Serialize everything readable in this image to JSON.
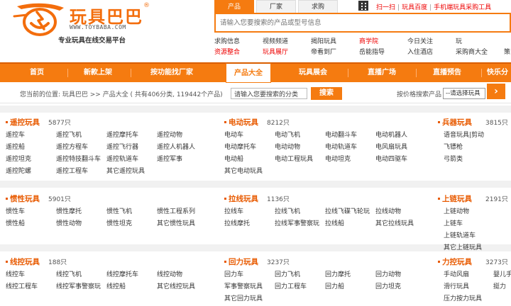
{
  "brand": {
    "name": "玩具巴巴",
    "reg": "®",
    "url": "WWW.TOYBABA.COM",
    "tagline": "专业玩具在线交易平台"
  },
  "search": {
    "tabs": [
      "产品",
      "厂家",
      "求购"
    ],
    "placeholder": "请输入您要搜索的产品或型号信息"
  },
  "top_links": {
    "scan": "扫一扫",
    "baidu": "玩具百度",
    "mobile": "手机端玩具采购工具"
  },
  "quick_links": {
    "row1": [
      "求购信息",
      "视频频道",
      "揭阳玩具",
      "商学院",
      "今日关注",
      "玩"
    ],
    "row2": [
      "资源整合",
      "玩具展厅",
      "帝看到厂",
      "岳能指导",
      "入住酒店",
      "采购商大全",
      "策"
    ],
    "row3": [
      "找物流",
      "玩具论坛",
      "我要采购",
      "行业资讯",
      "最新展会",
      "玩具网址",
      "更"
    ]
  },
  "nav": {
    "items": [
      "首页",
      "新款上架",
      "按功能找厂家",
      "产品大全",
      "玩具展会",
      "直播广场",
      "直播预告",
      "快乐分"
    ],
    "arrow": "›"
  },
  "crumb": {
    "text": "您当前的位置: 玩具巴巴 >> 产品大全 ( 共有406分类, 119442个产品)",
    "search_value": "请输入您要搜索的分类",
    "search_btn": "搜索",
    "cat_label": "按价格搜索产品",
    "cat_select": "--请选择玩具"
  },
  "categories": [
    {
      "title": "遥控玩具",
      "count": "5877只",
      "items": [
        "遥控车",
        "遥控飞机",
        "遥控摩托车",
        "遥控动物",
        "遥控船",
        "遥控方程车",
        "遥控飞行器",
        "遥控人机器人",
        "遥控坦克",
        "遥控特技翻斗车",
        "遥控轨道车",
        "遥控军事",
        "遥控陀螺",
        "遥控工程车",
        "其它遥控玩具"
      ]
    },
    {
      "title": "电动玩具",
      "count": "8212只",
      "items": [
        "电动车",
        "电动飞机",
        "电动翻斗车",
        "电动机器人",
        "电动摩托车",
        "电动动物",
        "电动轨道车",
        "电风扇玩具",
        "电动船",
        "电动工程玩具",
        "电动坦克",
        "电动四驱车",
        "其它电动玩具"
      ]
    },
    {
      "title": "兵器玩具",
      "count": "3815只",
      "items": [
        "语音玩具|剪动",
        "飞镖枪",
        "弓箭类"
      ]
    },
    {
      "title": "惯性玩具",
      "count": "5901只",
      "items": [
        "惯性车",
        "惯性摩托",
        "惯性飞机",
        "惯性工程系列",
        "惯性船",
        "惯性动物",
        "惯性坦克",
        "其它惯性玩具"
      ]
    },
    {
      "title": "拉线玩具",
      "count": "1136只",
      "items": [
        "拉线车",
        "拉线飞机",
        "拉线飞碟飞轮玩",
        "拉线动物",
        "拉线摩托",
        "拉线军事警察玩",
        "拉线船",
        "其它拉线玩具"
      ]
    },
    {
      "title": "上链玩具",
      "count": "2191只",
      "items": [
        "上链动物",
        "上链车",
        "上链轨道车",
        "其它上链玩具"
      ]
    },
    {
      "title": "线控玩具",
      "count": "188只",
      "items": [
        "线控车",
        "线控飞机",
        "线控摩托车",
        "线控动物",
        "线控工程车",
        "线控军事警察玩",
        "线控船",
        "其它线控玩具"
      ]
    },
    {
      "title": "回力玩具",
      "count": "3237只",
      "items": [
        "回力车",
        "回力飞机",
        "回力摩托",
        "回力动物",
        "军事警察玩具",
        "回力工程车",
        "回力船",
        "回力坦克",
        "其它回力玩具"
      ]
    },
    {
      "title": "力控玩具",
      "count": "3273只",
      "items": [
        "手动风扇",
        "婴儿手",
        "滑行玩具",
        "挺力",
        "压力按力玩具"
      ]
    }
  ],
  "colors": {
    "accent": "#f57b10",
    "title": "#e85a00",
    "link_red": "#e00000"
  }
}
